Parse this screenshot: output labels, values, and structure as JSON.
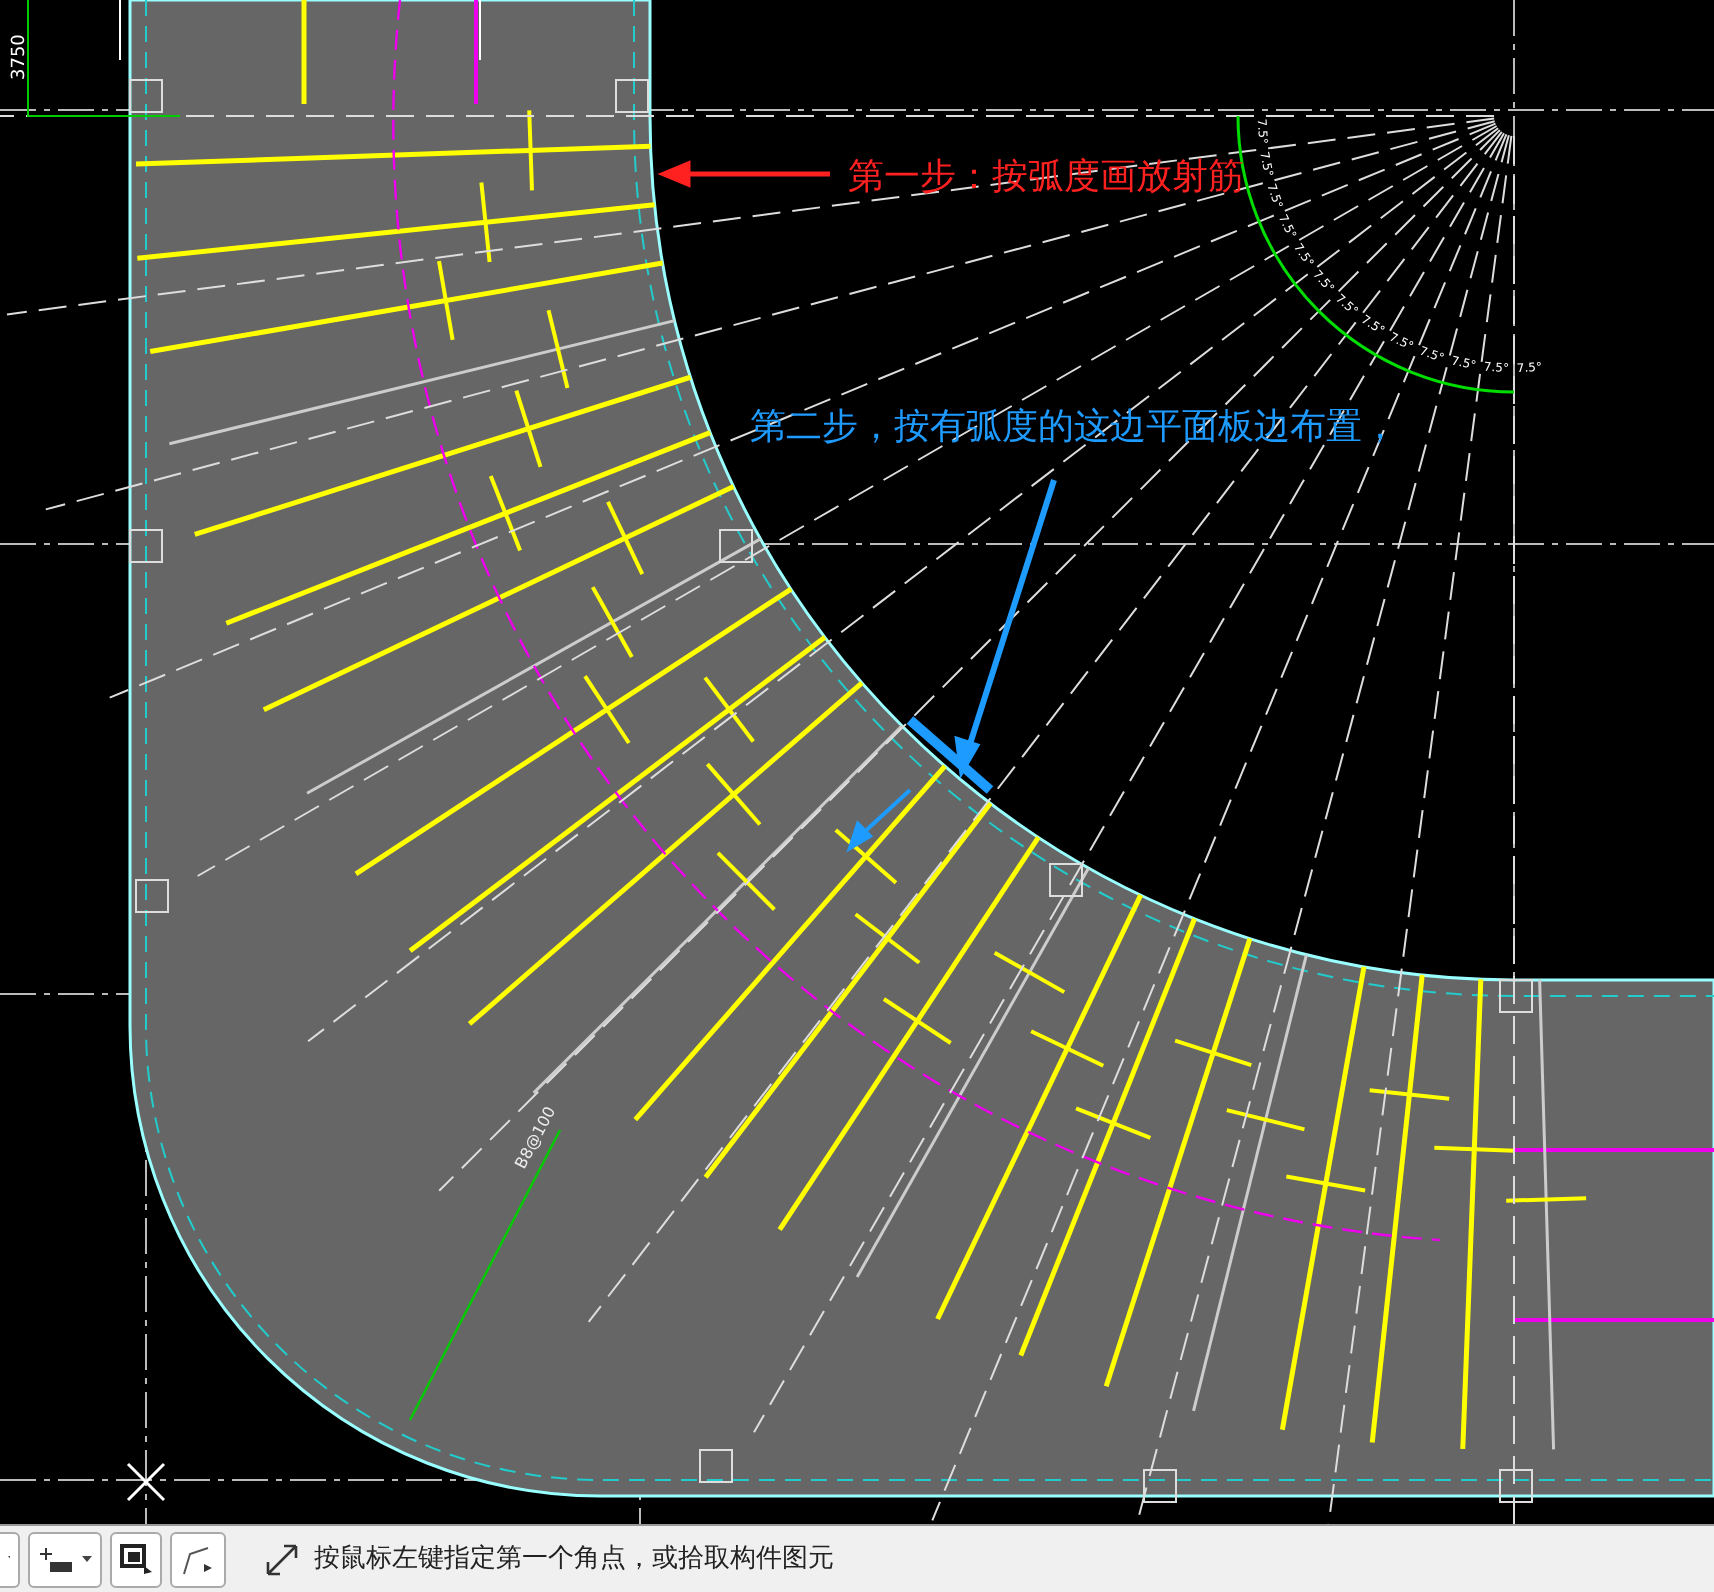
{
  "canvas": {
    "dimension": "3750",
    "rebar_label": "B8@100",
    "angle_labels": [
      "7.5°",
      "7.5°",
      "7.5°",
      "7.5°",
      "7.5°",
      "7.5°",
      "7.5°",
      "7.5°",
      "7.5°",
      "7.5°",
      "7.5°",
      "7.5°",
      "7.5°"
    ],
    "annotations": [
      {
        "kind": "step1",
        "text": "第一步：按弧度画放射筋",
        "color": "#ff2020"
      },
      {
        "kind": "step2",
        "text": "第二步，按有弧度的这边平面板边布置，",
        "color": "#1e9bff"
      }
    ]
  },
  "status_bar": {
    "prompt": "按鼠标左键指定第一个角点，或拾取构件图元"
  }
}
